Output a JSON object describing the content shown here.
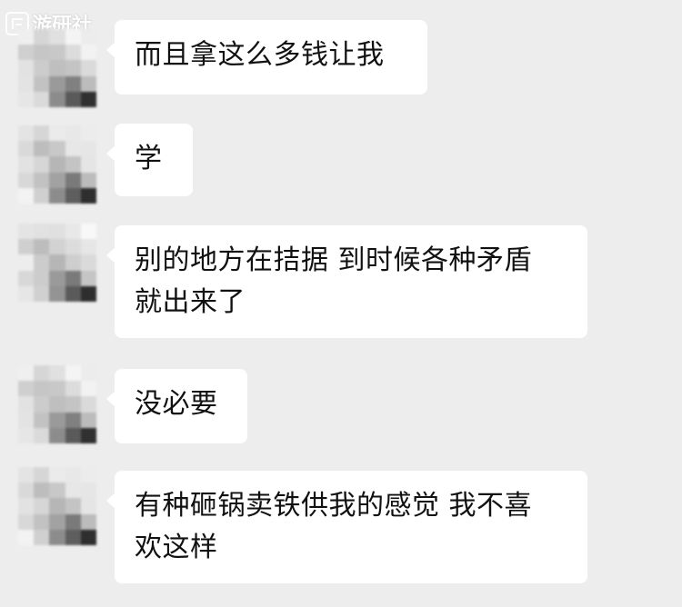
{
  "watermark": {
    "text": "游研社"
  },
  "messages": [
    {
      "lines": [
        "而且拿这么多钱让我"
      ]
    },
    {
      "lines": [
        "学"
      ]
    },
    {
      "lines": [
        "别的地方在拮据 到时候各种矛盾",
        "就出来了"
      ]
    },
    {
      "lines": [
        "没必要"
      ]
    },
    {
      "lines": [
        "有种砸锅卖铁供我的感觉 我不喜",
        "欢这样"
      ]
    }
  ]
}
